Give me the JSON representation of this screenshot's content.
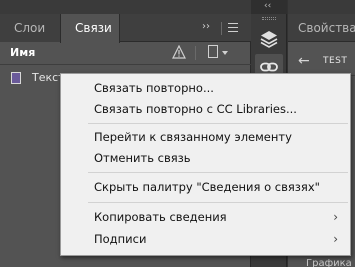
{
  "links_panel": {
    "tabs": [
      {
        "label": "Слои",
        "active": false
      },
      {
        "label": "Связи",
        "active": true
      }
    ],
    "more_glyph": "››",
    "column_header": {
      "name_label": "Имя"
    },
    "rows": [
      {
        "label": "Текст"
      }
    ]
  },
  "dock": {
    "collapse_glyph": "‹‹",
    "icons": [
      "layers-icon",
      "links-icon"
    ]
  },
  "properties_panel": {
    "tab_label": "Свойства",
    "document_title": "TEST",
    "bottom_label": "Графика"
  },
  "context_menu": {
    "items": [
      {
        "label": "Связать повторно...",
        "submenu": false
      },
      {
        "label": "Связать повторно с CC Libraries...",
        "submenu": false
      },
      {
        "label": "Перейти к связанному элементу",
        "submenu": false
      },
      {
        "label": "Отменить связь",
        "submenu": false
      },
      {
        "label": "Скрыть палитру \"Сведения о связях\"",
        "submenu": false
      },
      {
        "label": "Копировать сведения",
        "submenu": true
      },
      {
        "label": "Подписи",
        "submenu": true
      }
    ],
    "submenu_arrow": "›"
  }
}
